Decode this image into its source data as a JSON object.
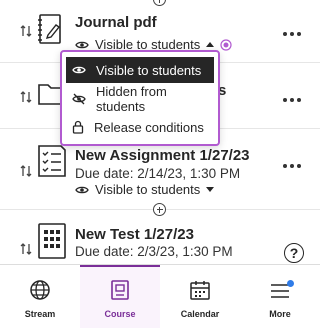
{
  "items": [
    {
      "title": "Journal pdf",
      "visibility": "Visible to students",
      "icon": "journal-icon"
    },
    {
      "title_suffix": "s",
      "icon": "folder-icon"
    },
    {
      "title": "New Assignment 1/27/23",
      "due": "Due date: 2/14/23, 1:30 PM",
      "visibility": "Visible to students",
      "icon": "assignment-icon"
    },
    {
      "title": "New Test 1/27/23",
      "due": "Due date: 2/3/23, 1:30 PM",
      "icon": "test-icon"
    }
  ],
  "visibility_menu": {
    "options": [
      {
        "label": "Visible to students",
        "icon": "eye-icon",
        "selected": true
      },
      {
        "label": "Hidden from students",
        "icon": "eye-slash-icon",
        "selected": false
      },
      {
        "label": "Release conditions",
        "icon": "lock-icon",
        "selected": false
      }
    ]
  },
  "help": {
    "label": "?"
  },
  "bottom_nav": {
    "tabs": [
      {
        "label": "Stream",
        "icon": "globe-icon",
        "active": false
      },
      {
        "label": "Course",
        "icon": "book-icon",
        "active": true
      },
      {
        "label": "Calendar",
        "icon": "calendar-icon",
        "active": false
      },
      {
        "label": "More",
        "icon": "menu-icon",
        "active": false,
        "badge": true
      }
    ]
  },
  "colors": {
    "accent": "#7a2e98",
    "menu_border": "#b15ad0",
    "selected_bg": "#262626",
    "badge": "#2f7ce8"
  }
}
